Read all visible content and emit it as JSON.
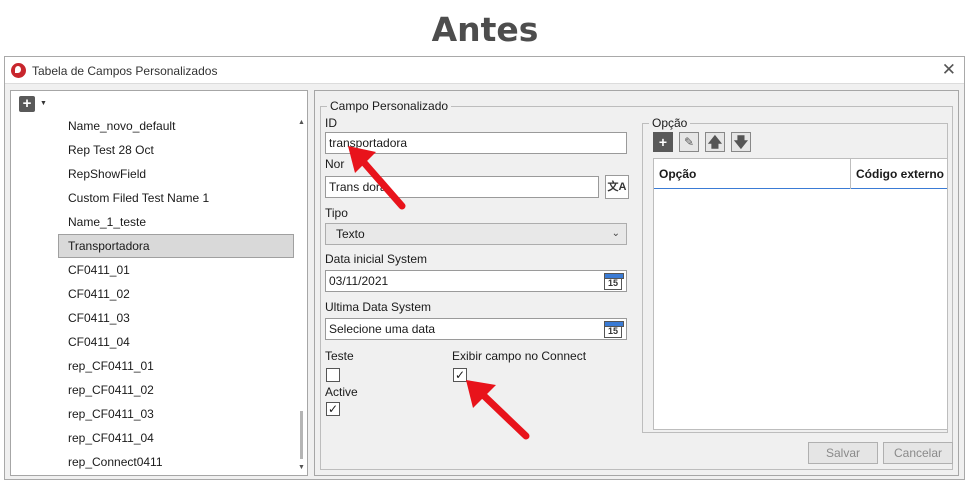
{
  "heading": "Antes",
  "window": {
    "title": "Tabela de Campos Personalizados"
  },
  "sidebar": {
    "items": [
      {
        "label": "Name_novo_default"
      },
      {
        "label": "Rep Test 28 Oct"
      },
      {
        "label": "RepShowField"
      },
      {
        "label": "Custom Filed Test Name 1"
      },
      {
        "label": "Name_1_teste"
      },
      {
        "label": "Transportadora",
        "selected": true
      },
      {
        "label": "CF0411_01"
      },
      {
        "label": "CF0411_02"
      },
      {
        "label": "CF0411_03"
      },
      {
        "label": "CF0411_04"
      },
      {
        "label": "rep_CF0411_01"
      },
      {
        "label": "rep_CF0411_02"
      },
      {
        "label": "rep_CF0411_03"
      },
      {
        "label": "rep_CF0411_04"
      },
      {
        "label": "rep_Connect0411"
      }
    ]
  },
  "form": {
    "group_title": "Campo Personalizado",
    "id_label": "ID",
    "id_value": "transportadora",
    "nome_label": "Nor",
    "nome_value": "Trans     dora",
    "tipo_label": "Tipo",
    "tipo_value": "Texto",
    "data_inicial_label": "Data inicial System",
    "data_inicial_value": "03/11/2021",
    "ultima_data_label": "Ultima Data System",
    "ultima_data_placeholder": "Selecione uma data",
    "calendar_day": "15",
    "translate_glyph": "文A",
    "teste_label": "Teste",
    "teste_checked": false,
    "exibir_label": "Exibir campo no Connect",
    "exibir_checked": true,
    "active_label": "Active",
    "active_checked": true,
    "check_mark": "✓"
  },
  "opcao": {
    "group_title": "Opção",
    "toolbar": [
      "plus-icon",
      "edit-icon",
      "arrow-up-icon",
      "arrow-down-icon"
    ],
    "columns": [
      "Opção",
      "Código externo"
    ]
  },
  "buttons": {
    "save": "Salvar",
    "cancel": "Cancelar"
  },
  "colors": {
    "accent": "#3a7bd5",
    "annotation_arrow": "#e8131b",
    "brand": "#c8262d"
  }
}
